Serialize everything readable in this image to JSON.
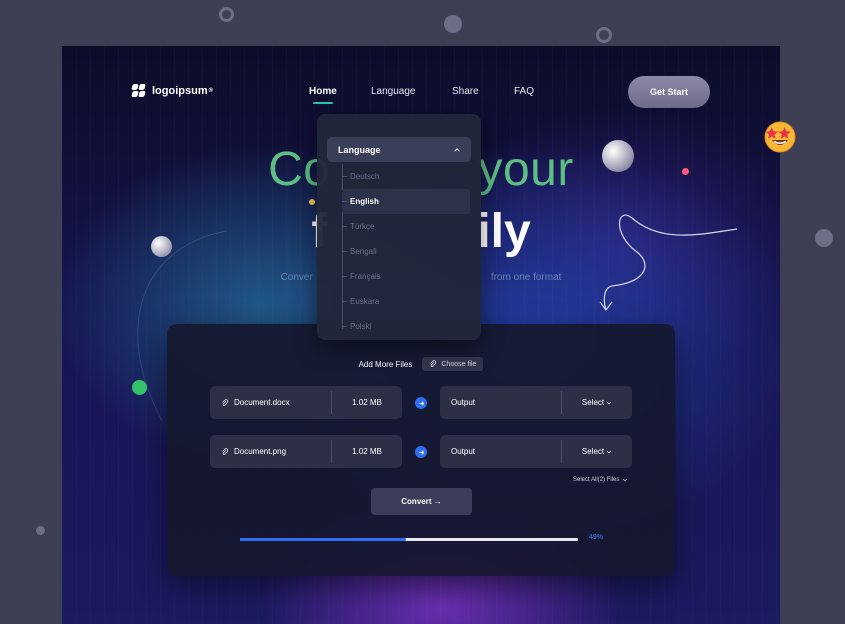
{
  "brand": {
    "logo_text": "logoipsum",
    "logo_suffix": "®"
  },
  "nav": {
    "items": [
      {
        "label": "Home",
        "active": true
      },
      {
        "label": "Language",
        "active": false
      },
      {
        "label": "Share",
        "active": false
      },
      {
        "label": "FAQ",
        "active": false
      }
    ],
    "cta_label": "Get Start"
  },
  "hero": {
    "line1_left": "Co",
    "line1_right": "your",
    "line2_left": "f",
    "line2_right": "ily",
    "subtitle_left": "Conver",
    "subtitle_right": "from one format"
  },
  "language_dropdown": {
    "header_label": "Language",
    "selected": "English",
    "options": [
      "Deutsch",
      "English",
      "Türkçe",
      "Bengali",
      "Français",
      "Euskara",
      "Polski"
    ]
  },
  "converter": {
    "add_more_label": "Add More Files",
    "choose_file_label": "Choose file",
    "files": [
      {
        "name": "Document.docx",
        "size": "1.02 MB",
        "output_label": "Output",
        "select_label": "Select"
      },
      {
        "name": "Document.png",
        "size": "1.02 MB",
        "output_label": "Output",
        "select_label": "Select"
      }
    ],
    "select_all_label": "Select All(2) Files",
    "convert_label": "Convert →",
    "progress": {
      "value": 49,
      "label": "49%"
    }
  },
  "colors": {
    "accent_green": "#5dbf82",
    "accent_blue": "#2f6ef0",
    "nav_underline": "#27c2b6",
    "outer_background": "#3e3e55"
  },
  "icons": [
    "logo-mark-icon",
    "chevron-up-icon",
    "paperclip-icon",
    "arrow-right-icon",
    "chevron-down-icon",
    "star-eyes-emoji-icon"
  ]
}
